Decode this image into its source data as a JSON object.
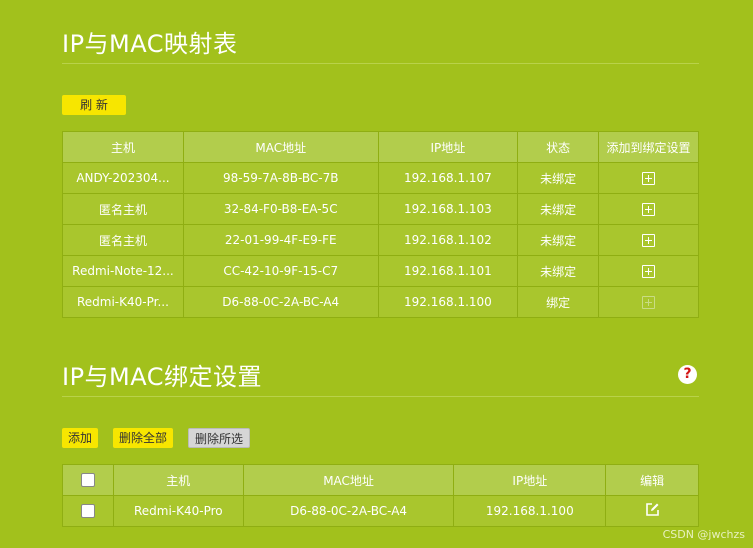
{
  "mapping": {
    "title": "IP与MAC映射表",
    "refresh_label": "刷 新",
    "columns": [
      "主机",
      "MAC地址",
      "IP地址",
      "状态",
      "添加到绑定设置"
    ],
    "rows": [
      {
        "host": "ANDY-202304...",
        "mac": "98-59-7A-8B-BC-7B",
        "ip": "192.168.1.107",
        "status": "未绑定",
        "action_icon": "plus-square-icon",
        "action_enabled": true
      },
      {
        "host": "匿名主机",
        "mac": "32-84-F0-B8-EA-5C",
        "ip": "192.168.1.103",
        "status": "未绑定",
        "action_icon": "plus-square-icon",
        "action_enabled": true
      },
      {
        "host": "匿名主机",
        "mac": "22-01-99-4F-E9-FE",
        "ip": "192.168.1.102",
        "status": "未绑定",
        "action_icon": "plus-square-icon",
        "action_enabled": true
      },
      {
        "host": "Redmi-Note-12...",
        "mac": "CC-42-10-9F-15-C7",
        "ip": "192.168.1.101",
        "status": "未绑定",
        "action_icon": "plus-square-icon",
        "action_enabled": true
      },
      {
        "host": "Redmi-K40-Pr...",
        "mac": "D6-88-0C-2A-BC-A4",
        "ip": "192.168.1.100",
        "status": "绑定",
        "action_icon": "plus-square-icon",
        "action_enabled": false
      }
    ]
  },
  "binding": {
    "title": "IP与MAC绑定设置",
    "help_symbol": "?",
    "add_label": "添加",
    "delete_all_label": "删除全部",
    "delete_selected_label": "删除所选",
    "columns": [
      "主机",
      "MAC地址",
      "IP地址",
      "编辑"
    ],
    "rows": [
      {
        "host": "Redmi-K40-Pro",
        "mac": "D6-88-0C-2A-BC-A4",
        "ip": "192.168.1.100",
        "checked": false,
        "edit_icon": "edit-icon"
      }
    ],
    "header_checked": false
  },
  "watermark": "CSDN @jwchzs",
  "colors": {
    "background": "#a2c11c",
    "button_yellow": "#f7e600",
    "help_red": "#d31515"
  }
}
